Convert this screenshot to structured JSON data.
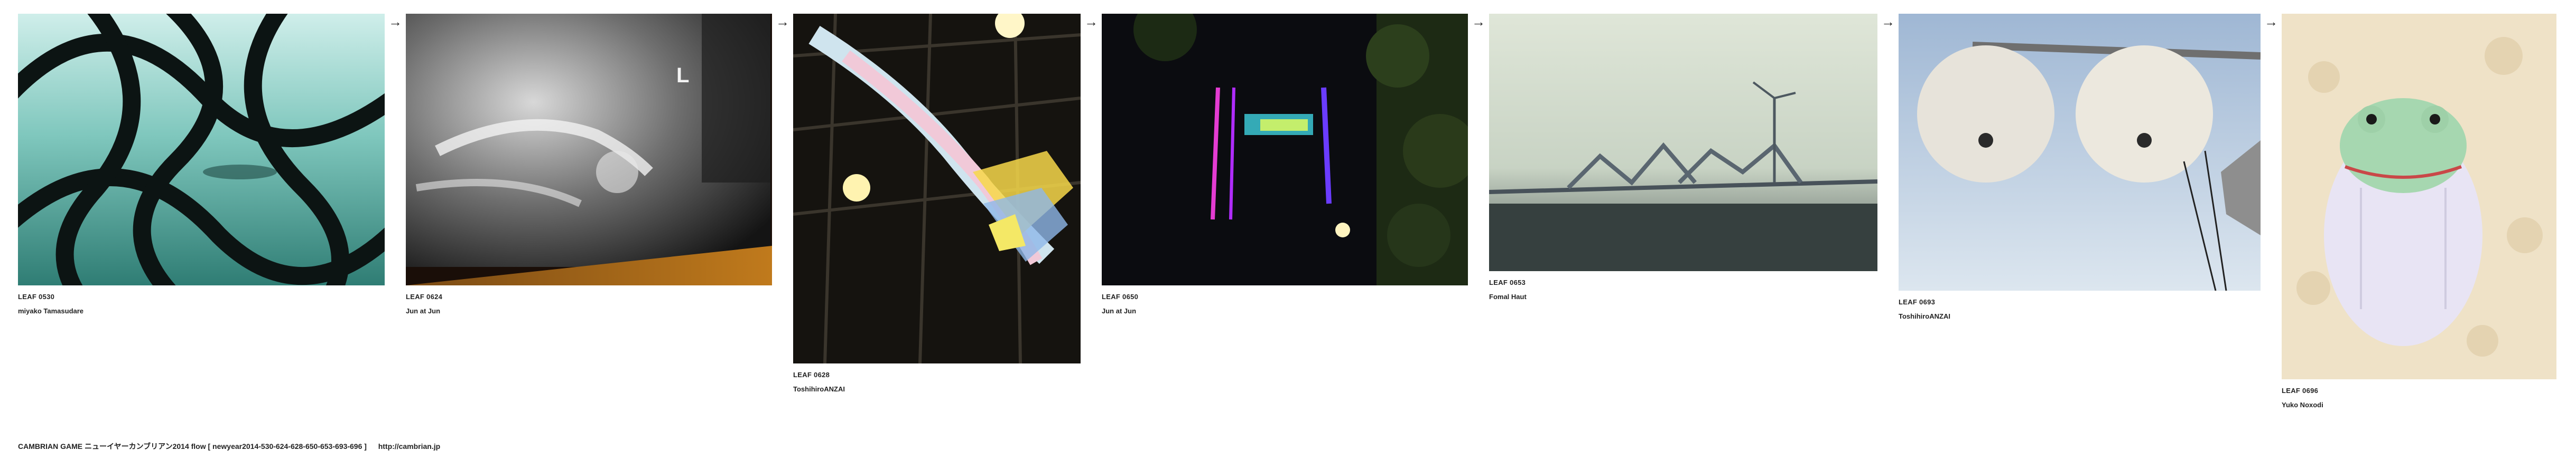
{
  "flow": {
    "arrow_glyph": "→",
    "leaves": [
      {
        "id": "LEAF 0530",
        "author": "miyako Tamasudare",
        "image": "teal-lattice-window-sea-photo"
      },
      {
        "id": "LEAF 0624",
        "author": "Jun at Jun",
        "image": "shoulder-xray-photo"
      },
      {
        "id": "LEAF 0628",
        "author": "ToshihiroANZAI",
        "image": "ribbon-sculpture-atrium-photo"
      },
      {
        "id": "LEAF 0650",
        "author": "Jun at Jun",
        "image": "neon-tower-night-photo"
      },
      {
        "id": "LEAF 0653",
        "author": "Fomal Haut",
        "image": "gate-bridge-wind-turbine-photo"
      },
      {
        "id": "LEAF 0693",
        "author": "ToshihiroANZAI",
        "image": "twin-street-lamps-sky-photo"
      },
      {
        "id": "LEAF 0696",
        "author": "Yuko Noxodi",
        "image": "frog-figurine-photo"
      }
    ]
  },
  "footer": {
    "title": "CAMBRIAN GAME  ニューイヤーカンブリアン2014  flow [ newyear2014-530-624-628-650-653-693-696 ]",
    "link": "http://cambrian.jp"
  }
}
